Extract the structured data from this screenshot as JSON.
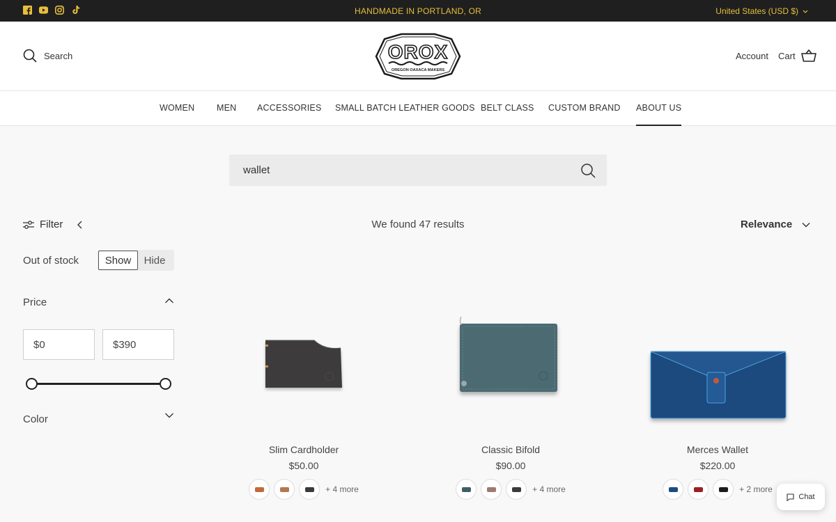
{
  "announcement": {
    "text": "HANDMADE IN PORTLAND, OR",
    "currency": "United States (USD $)",
    "social_icons": [
      "facebook-icon",
      "youtube-icon",
      "instagram-icon",
      "tiktok-icon"
    ]
  },
  "header": {
    "search_label": "Search",
    "logo_text": "OROX",
    "logo_subtext": "OREGON OAXACA MAKERS",
    "account_label": "Account",
    "cart_label": "Cart"
  },
  "nav": {
    "items": [
      {
        "label": "WOMEN"
      },
      {
        "label": "MEN"
      },
      {
        "label": "ACCESSORIES"
      },
      {
        "label": "SMALL BATCH LEATHER GOODS"
      },
      {
        "label": "BELT CLASS"
      },
      {
        "label": "CUSTOM BRAND"
      },
      {
        "label": "ABOUT US",
        "active": true
      }
    ]
  },
  "search": {
    "query": "wallet"
  },
  "toolbar": {
    "filter_label": "Filter",
    "results_text": "We found 47 results",
    "sort_label": "Relevance"
  },
  "filters": {
    "out_of_stock_label": "Out of stock",
    "show_label": "Show",
    "hide_label": "Hide",
    "price_label": "Price",
    "price_min": "$0",
    "price_max": "$390",
    "price_range_fraction": [
      0,
      1
    ],
    "color_label": "Color"
  },
  "products": [
    {
      "name": "Slim Cardholder",
      "price": "$50.00",
      "swatch_colors": [
        "#c06a3a",
        "#b5774f",
        "#3a3a3a"
      ],
      "more": "+ 4 more"
    },
    {
      "name": "Classic Bifold",
      "price": "$90.00",
      "swatch_colors": [
        "#3f5f66",
        "#9c7b72",
        "#3b3b3b"
      ],
      "more": "+ 4 more"
    },
    {
      "name": "Merces Wallet",
      "price": "$220.00",
      "swatch_colors": [
        "#1e4a82",
        "#9c1f23",
        "#1d1d1d"
      ],
      "more": "+ 2 more"
    }
  ],
  "chat": {
    "label": "Chat"
  },
  "colors": {
    "announcement_bg": "#1f1f1f",
    "announcement_text": "#e6bf3c"
  }
}
